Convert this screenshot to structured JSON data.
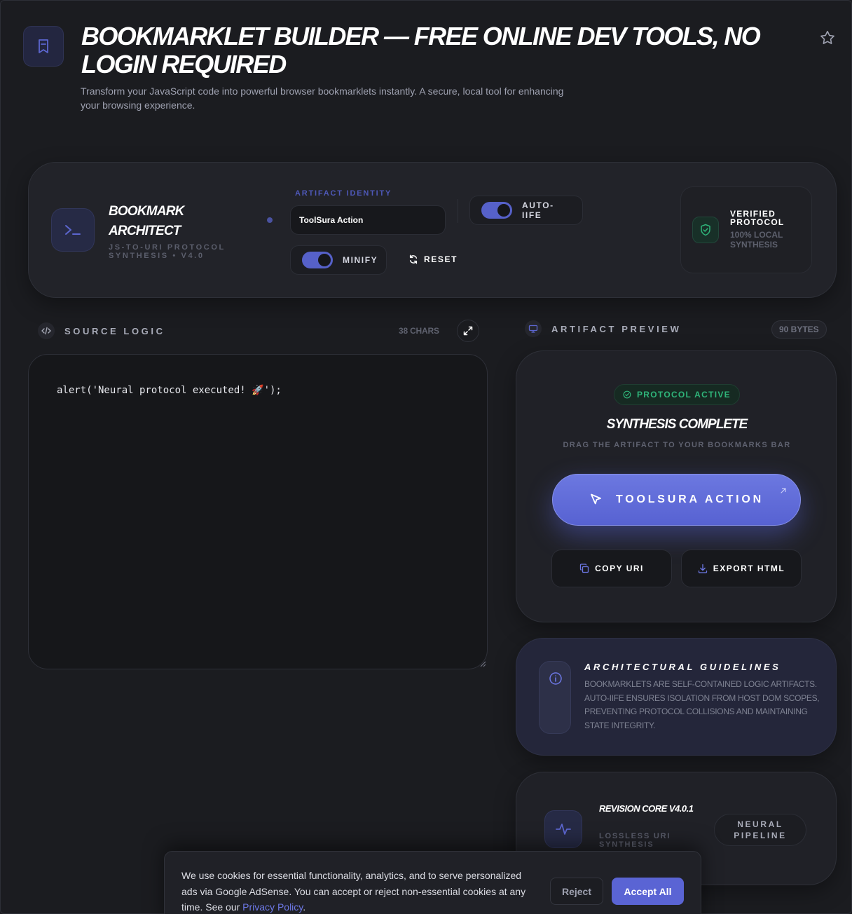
{
  "header": {
    "title": "BOOKMARKLET BUILDER — FREE ONLINE DEV TOOLS, NO LOGIN REQUIRED",
    "subtitle": "Transform your JavaScript code into powerful browser bookmarklets instantly. A secure, local tool for enhancing your browsing experience.",
    "icons": {
      "logo": "bookmark-icon",
      "favorite": "star-icon"
    }
  },
  "panel": {
    "title": "BOOKMARK ARCHITECT",
    "subtitle": "JS-TO-URI PROTOCOL SYNTHESIS • V4.0",
    "identity_label": "ARTIFACT IDENTITY",
    "identity_value": "ToolSura Action",
    "auto_iife": {
      "label": "AUTO-IIFE",
      "on": true
    },
    "minify": {
      "label": "MINIFY",
      "on": true
    },
    "reset_label": "RESET",
    "verified_title": "VERIFIED PROTOCOL",
    "verified_sub": "100% LOCAL SYNTHESIS"
  },
  "source": {
    "label": "SOURCE LOGIC",
    "chars": "38 CHARS",
    "code": "alert('Neural protocol executed! 🚀');"
  },
  "preview": {
    "label": "ARTIFACT PREVIEW",
    "bytes": "90 BYTES",
    "status": "PROTOCOL ACTIVE",
    "title": "SYNTHESIS COMPLETE",
    "hint": "DRAG THE ARTIFACT TO YOUR BOOKMARKS BAR",
    "bookmarklet_label": "TOOLSURA ACTION",
    "copy_label": "COPY URI",
    "export_label": "EXPORT HTML"
  },
  "guidelines": {
    "title": "ARCHITECTURAL GUIDELINES",
    "text": "BOOKMARKLETS ARE SELF-CONTAINED LOGIC ARTIFACTS. AUTO-IIFE ENSURES ISOLATION FROM HOST DOM SCOPES, PREVENTING PROTOCOL COLLISIONS AND MAINTAINING STATE INTEGRITY."
  },
  "revision": {
    "title": "REVISION CORE V4.0.1",
    "subtitle": "LOSSLESS URI SYNTHESIS",
    "pipeline": "NEURAL PIPELINE"
  },
  "cookie": {
    "text": "We use cookies for essential functionality, analytics, and to serve personalized ads via Google AdSense. You can accept or reject non-essential cookies at any time. See our ",
    "link": "Privacy Policy",
    "tail": ".",
    "reject": "Reject",
    "accept": "Accept All"
  },
  "colors": {
    "background": "#1b1c20",
    "accent": "#5a64d4",
    "success": "#2fb57a",
    "muted": "#5e616e"
  }
}
